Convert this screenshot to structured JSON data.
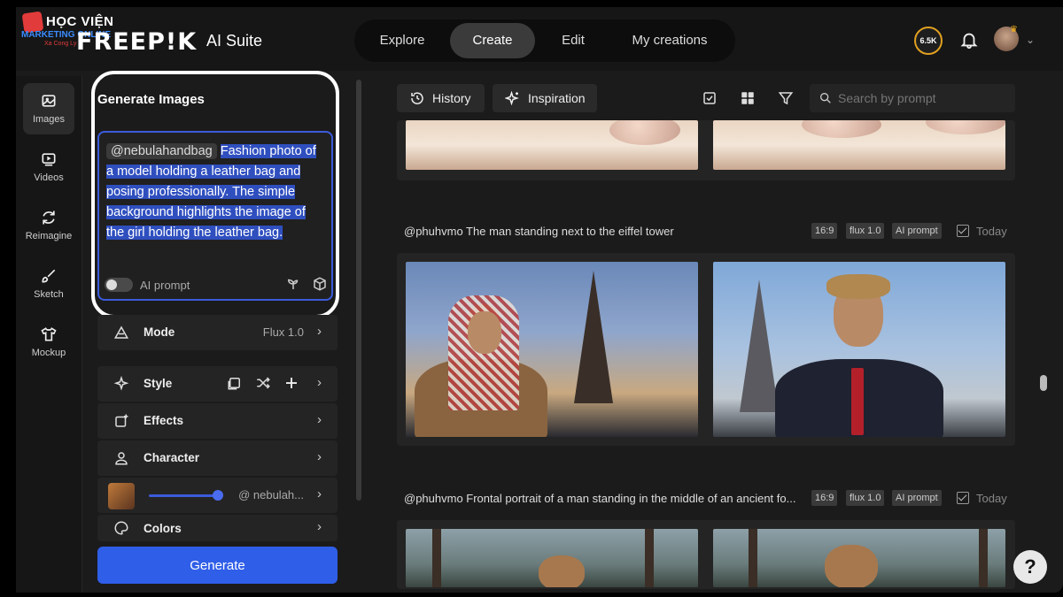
{
  "watermark": {
    "line1": "HỌC VIỆN",
    "line2": "MARKETING ONLINE",
    "line3": "Xa Cong Ly"
  },
  "brand": {
    "logo": "FREEP!K",
    "suite": "AI Suite"
  },
  "nav": {
    "tabs": [
      {
        "label": "Explore"
      },
      {
        "label": "Create"
      },
      {
        "label": "Edit"
      },
      {
        "label": "My creations"
      }
    ],
    "active": "Create"
  },
  "header": {
    "credits": "6.5K"
  },
  "rail": {
    "items": [
      {
        "label": "Images",
        "icon": "images-icon",
        "active": true
      },
      {
        "label": "Videos",
        "icon": "video-icon"
      },
      {
        "label": "Reimagine",
        "icon": "refresh-icon"
      },
      {
        "label": "Sketch",
        "icon": "brush-icon"
      },
      {
        "label": "Mockup",
        "icon": "shirt-icon"
      }
    ]
  },
  "panel": {
    "title": "Generate Images",
    "prompt": {
      "mention": "@nebulahandbag",
      "text": "Fashion photo of a model holding a leather bag and posing professionally. The simple background highlights the image of the girl holding the leather bag."
    },
    "ai_prompt_label": "AI prompt",
    "mode": {
      "label": "Mode",
      "value": "Flux 1.0"
    },
    "style": {
      "label": "Style"
    },
    "effects": {
      "label": "Effects"
    },
    "character": {
      "label": "Character",
      "value": "@ nebulah..."
    },
    "colors": {
      "label": "Colors"
    },
    "generate_label": "Generate"
  },
  "toolbar": {
    "history_label": "History",
    "inspiration_label": "Inspiration",
    "search_placeholder": "Search by prompt"
  },
  "gallery": [
    {
      "caption": "@phuhvmo The man standing next to the eiffel tower",
      "tags": [
        "16:9",
        "flux 1.0",
        "AI prompt"
      ],
      "date": "Today"
    },
    {
      "caption": "@phuhvmo Frontal portrait of a man standing in the middle of an ancient fo...",
      "tags": [
        "16:9",
        "flux 1.0",
        "AI prompt"
      ],
      "date": "Today"
    }
  ],
  "help_label": "?"
}
